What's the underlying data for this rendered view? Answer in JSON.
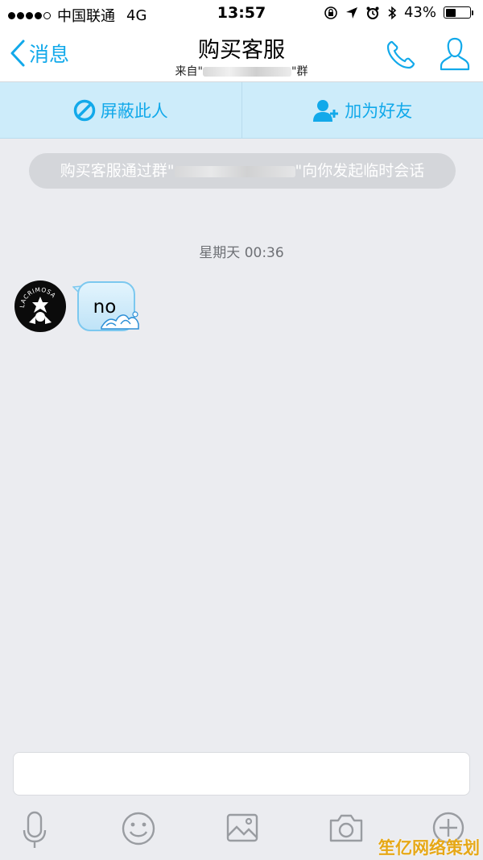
{
  "status_bar": {
    "carrier": "中国联通",
    "network": "4G",
    "time": "13:57",
    "battery": "43%",
    "battery_level": 0.43
  },
  "nav": {
    "back_label": "消息",
    "title": "购买客服",
    "subtitle_prefix": "来自\"",
    "subtitle_suffix": "\"群"
  },
  "actions": {
    "block_label": "屏蔽此人",
    "add_friend_label": "加为好友"
  },
  "chat": {
    "notice_prefix": "购买客服通过群\"",
    "notice_suffix": "\"向你发起临时会话",
    "timestamp": "星期天 00:36",
    "message": "no",
    "avatar_text": "LACRIMOSA"
  },
  "input": {
    "placeholder": ""
  },
  "icons": {
    "back": "chevron-left-icon",
    "phone": "phone-icon",
    "profile": "profile-icon",
    "block": "block-icon",
    "add_friend": "add-friend-icon",
    "voice": "microphone-icon",
    "emoji": "emoji-icon",
    "image": "image-icon",
    "camera": "camera-icon",
    "more": "plus-icon"
  },
  "colors": {
    "accent": "#12a9ea",
    "action_bar_bg": "#cdecfa",
    "chat_bg": "#ebecf0"
  },
  "watermark": "笙亿网络策划"
}
